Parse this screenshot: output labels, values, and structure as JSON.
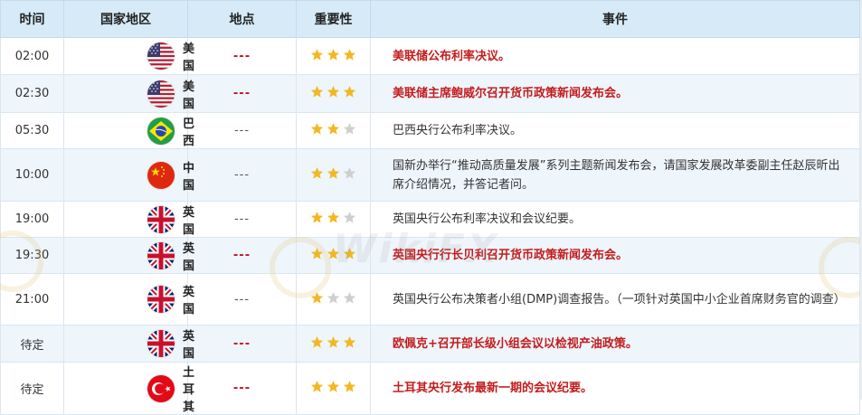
{
  "headers": {
    "time": "时间",
    "country": "国家地区",
    "location": "地点",
    "importance": "重要性",
    "event": "事件"
  },
  "watermark": "WikiFX",
  "colors": {
    "header_bg": "#d6eaf7",
    "alt_row_bg": "#eef5fb",
    "high_importance_text": "#c41c1c",
    "star_on": "#f2b824",
    "star_off": "#cfcfcf"
  },
  "rows": [
    {
      "time": "02:00",
      "flag": "us-flag-icon",
      "country": "美国",
      "location": "---",
      "stars": 3,
      "high": true,
      "event": "美联储公布利率决议。"
    },
    {
      "time": "02:30",
      "flag": "us-flag-icon",
      "country": "美国",
      "location": "---",
      "stars": 3,
      "high": true,
      "event": "美联储主席鲍威尔召开货币政策新闻发布会。"
    },
    {
      "time": "05:30",
      "flag": "br-flag-icon",
      "country": "巴西",
      "location": "---",
      "stars": 2,
      "high": false,
      "event": "巴西央行公布利率决议。"
    },
    {
      "time": "10:00",
      "flag": "cn-flag-icon",
      "country": "中国",
      "location": "---",
      "stars": 2,
      "high": false,
      "event": "国新办举行“推动高质量发展”系列主题新闻发布会，请国家发展改革委副主任赵辰昕出席介绍情况，并答记者问。"
    },
    {
      "time": "19:00",
      "flag": "uk-flag-icon",
      "country": "英国",
      "location": "---",
      "stars": 2,
      "high": false,
      "event": "英国央行公布利率决议和会议纪要。"
    },
    {
      "time": "19:30",
      "flag": "uk-flag-icon",
      "country": "英国",
      "location": "---",
      "stars": 3,
      "high": true,
      "event": "英国央行行长贝利召开货币政策新闻发布会。"
    },
    {
      "time": "21:00",
      "flag": "uk-flag-icon",
      "country": "英国",
      "location": "---",
      "stars": 1,
      "high": false,
      "event": "英国央行公布决策者小组(DMP)调查报告。（一项针对英国中小企业首席财务官的调查）"
    },
    {
      "time": "待定",
      "flag": "uk-flag-icon",
      "country": "英国",
      "location": "---",
      "stars": 3,
      "high": true,
      "event": "欧佩克+召开部长级小组会议以检视产油政策。"
    },
    {
      "time": "待定",
      "flag": "tr-flag-icon",
      "country": "土耳其",
      "location": "---",
      "stars": 3,
      "high": true,
      "event": "土耳其央行发布最新一期的会议纪要。"
    }
  ]
}
